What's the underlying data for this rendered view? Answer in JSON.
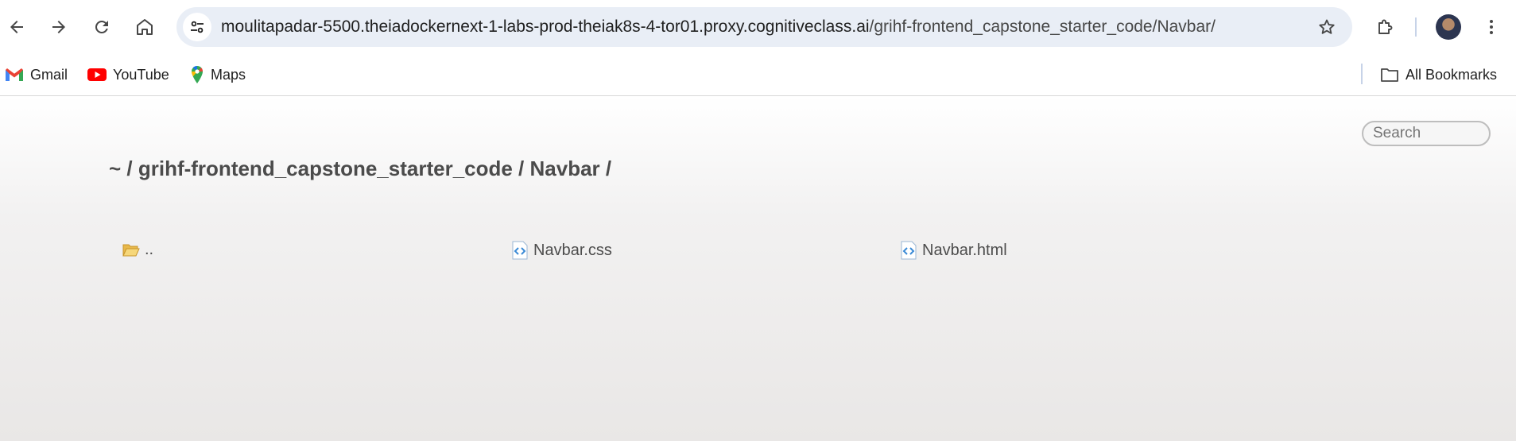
{
  "browser": {
    "url_host": "moulitapadar-5500.theiadockernext-1-labs-prod-theiak8s-4-tor01.proxy.cognitiveclass.ai",
    "url_path": "/grihf-frontend_capstone_starter_code/Navbar/",
    "icons": {
      "back": "back-arrow-icon",
      "forward": "forward-arrow-icon",
      "reload": "reload-icon",
      "home": "home-icon",
      "site_info": "tune-icon",
      "bookmark": "star-icon",
      "extensions": "puzzle-icon",
      "menu": "kebab-menu-icon"
    }
  },
  "bookmarks": {
    "items": [
      {
        "label": "Gmail",
        "icon": "gmail-icon"
      },
      {
        "label": "YouTube",
        "icon": "youtube-icon"
      },
      {
        "label": "Maps",
        "icon": "maps-icon"
      }
    ],
    "all_bookmarks_label": "All Bookmarks"
  },
  "page": {
    "search_placeholder": "Search",
    "breadcrumb": "~ / grihf-frontend_capstone_starter_code / Navbar /",
    "entries": [
      {
        "name": "..",
        "type": "folder"
      },
      {
        "name": "Navbar.css",
        "type": "code-file"
      },
      {
        "name": "Navbar.html",
        "type": "code-file"
      }
    ]
  }
}
